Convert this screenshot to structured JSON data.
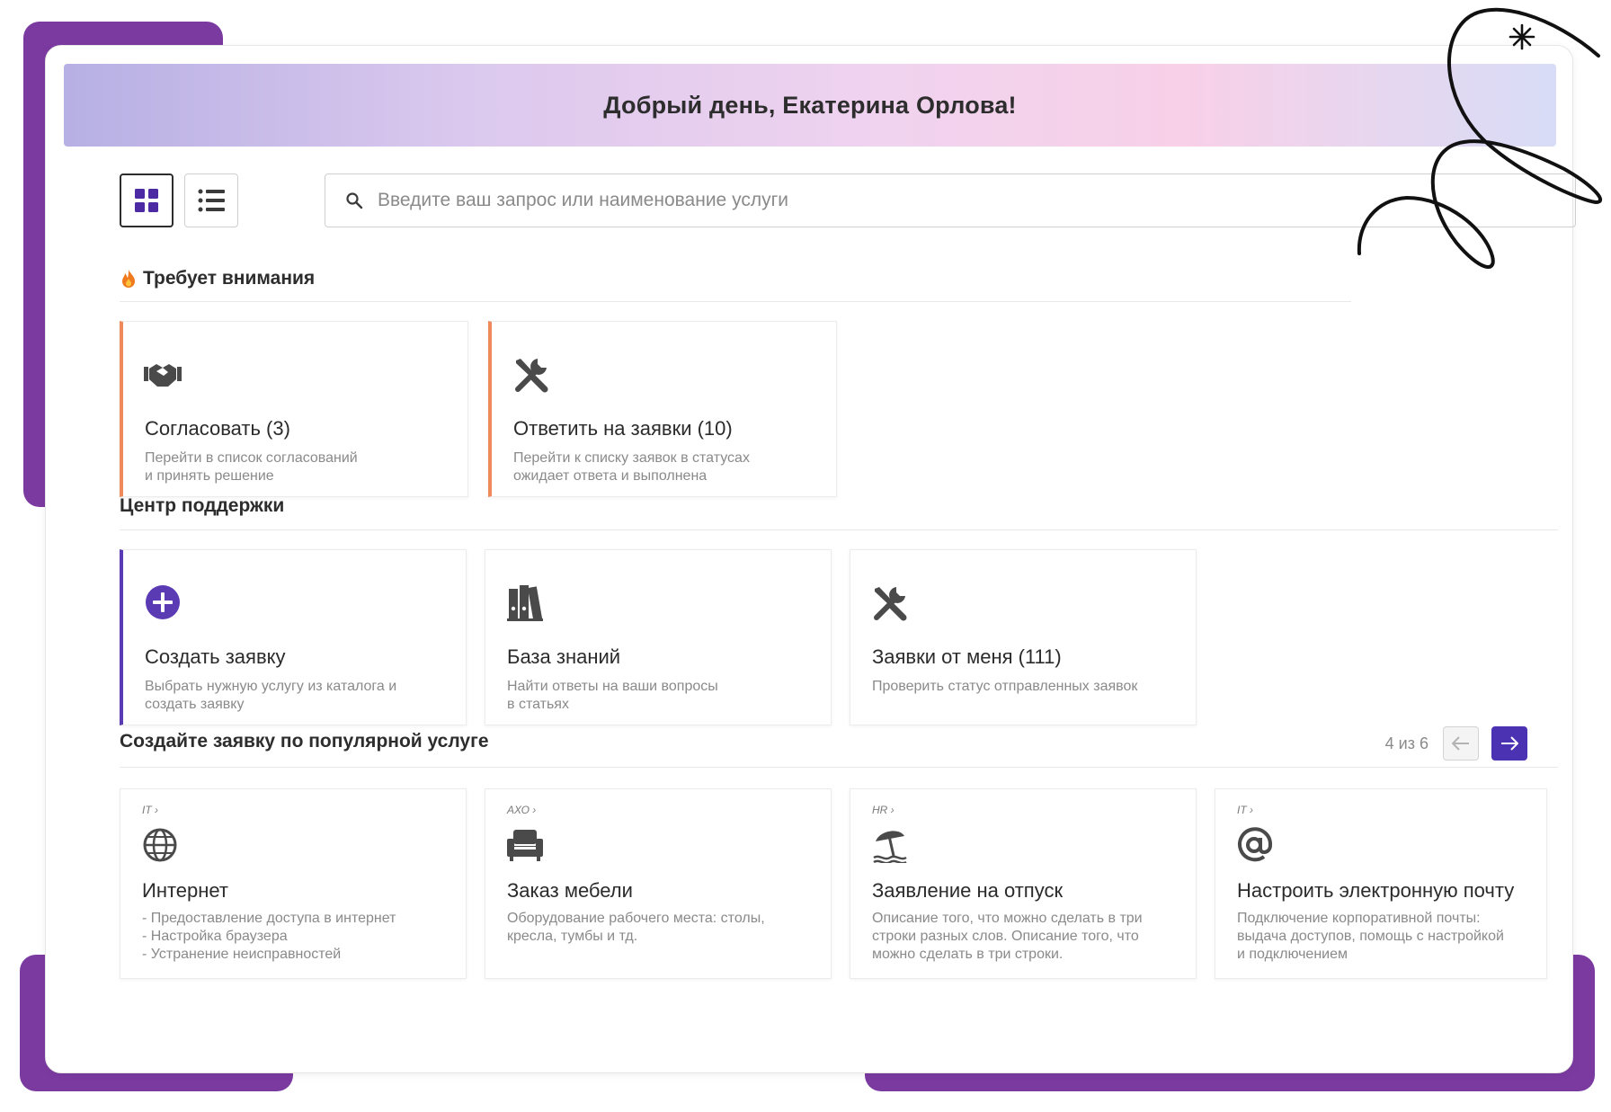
{
  "colors": {
    "brand_purple": "#7b3aa0",
    "accent_orange": "#ef8a5a",
    "accent_indigo": "#5a3bb3",
    "pager_active": "#4b32b3"
  },
  "banner": {
    "greeting": "Добрый день, Екатерина Орлова!"
  },
  "toolbar": {
    "grid_view_icon": "grid-icon",
    "list_view_icon": "list-icon",
    "search_placeholder": "Введите ваш запрос или наименование услуги",
    "search_value": ""
  },
  "attention": {
    "title": "Требует внимания",
    "cards": [
      {
        "icon": "handshake-icon",
        "title": "Согласовать (3)",
        "desc": "Перейти в список согласований\nи принять решение"
      },
      {
        "icon": "tools-icon",
        "title": "Ответить на заявки (10)",
        "desc": "Перейти к списку заявок в статусах\nожидает ответа и выполнена"
      }
    ]
  },
  "support": {
    "title": "Центр поддержки",
    "cards": [
      {
        "icon": "plus-circle-icon",
        "title": "Создать заявку",
        "desc": "Выбрать нужную услугу из каталога и\nсоздать заявку"
      },
      {
        "icon": "books-icon",
        "title": "База знаний",
        "desc": "Найти ответы на ваши вопросы\nв статьях"
      },
      {
        "icon": "tools-icon",
        "title": "Заявки от меня (111)",
        "desc": "Проверить статус отправленных заявок"
      }
    ]
  },
  "popular": {
    "title": "Создайте заявку по популярной услуге",
    "pager_text": "4 из 6",
    "cards": [
      {
        "crumb": "IT ›",
        "icon": "globe-icon",
        "title": "Интернет",
        "desc": "- Предоставление доступа в интернет\n- Настройка браузера\n- Устранение неисправностей"
      },
      {
        "crumb": "АХО ›",
        "icon": "armchair-icon",
        "title": "Заказ мебели",
        "desc": "Оборудование рабочего места: столы,\nкресла, тумбы и тд."
      },
      {
        "crumb": "HR ›",
        "icon": "beach-umbrella-icon",
        "title": "Заявление на отпуск",
        "desc": "Описание того, что можно сделать в три\nстроки разных слов. Описание того, что\nможно сделать в три строки."
      },
      {
        "crumb": "IT ›",
        "icon": "at-sign-icon",
        "title": "Настроить электронную почту",
        "desc": "Подключение корпоративной почты:\nвыдача доступов, помощь с настройкой\nи подключением"
      }
    ]
  }
}
